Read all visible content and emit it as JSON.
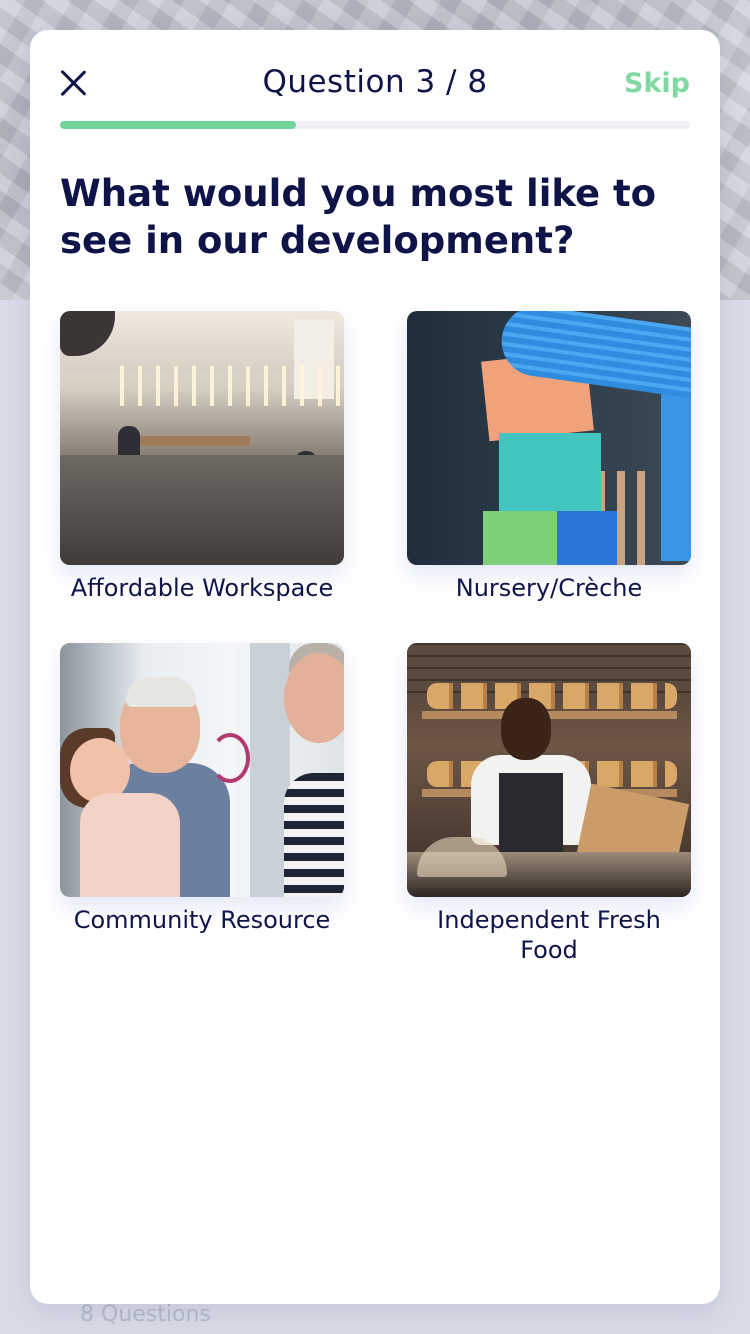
{
  "background": {
    "footer_text": "8 Questions"
  },
  "header": {
    "close_icon": "close-icon",
    "question_counter": "Question 3 / 8",
    "skip_label": "Skip",
    "progress_fraction": 0.375
  },
  "question": {
    "title": "What would you most like to see in our development?"
  },
  "options": [
    {
      "label": "Affordable Workspace",
      "image": "office-photo"
    },
    {
      "label": "Nursery/Crèche",
      "image": "toy-blocks-photo"
    },
    {
      "label": "Community Resource",
      "image": "grandparents-child-photo"
    },
    {
      "label": "Independent Fresh Food",
      "image": "bakery-photo"
    }
  ],
  "colors": {
    "navy_text": "#0f1448",
    "accent_green": "#7fd9a0",
    "progress_green": "#6fd39a"
  }
}
